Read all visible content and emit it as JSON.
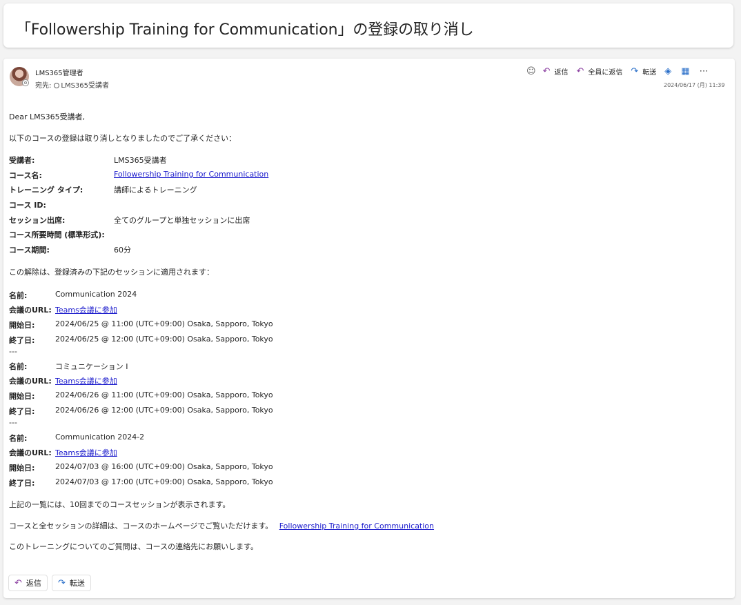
{
  "subject": "「Followership Training for Communication」の登録の取り消し",
  "header": {
    "sender": "LMS365管理者",
    "to_label": "宛先:",
    "recipient": "LMS365受講者",
    "date": "2024/06/17 (月) 11:39",
    "toolbar": {
      "reply": "返信",
      "reply_all": "全員に返信",
      "forward": "転送"
    }
  },
  "body": {
    "greeting": "Dear LMS365受講者,",
    "intro": "以下のコースの登録は取り消しとなりましたのでご了承ください：",
    "details": [
      {
        "label": "受講者:",
        "value": "LMS365受講者"
      },
      {
        "label": "コース名:",
        "value": "Followership Training for Communication"
      },
      {
        "label": "トレーニング タイプ:",
        "value": "講師によるトレーニング"
      },
      {
        "label": "コース ID:",
        "value": ""
      },
      {
        "label": "セッション出席:",
        "value": "全てのグループと単独セッションに出席"
      },
      {
        "label": "コース所要時間 (標準形式):",
        "value": ""
      },
      {
        "label": "コース期間:",
        "value": "60分"
      }
    ],
    "sessions_intro": "この解除は、登録済みの下記のセッションに適用されます：",
    "labels": {
      "name": "名前:",
      "url": "会議のURL:",
      "start": "開始日:",
      "end": "終了日:",
      "separator": "---"
    },
    "sessions": [
      {
        "name": "Communication 2024",
        "url": "Teams会議に参加",
        "start": "2024/06/25 @ 11:00 (UTC+09:00) Osaka, Sapporo, Tokyo",
        "end": "2024/06/25 @ 12:00 (UTC+09:00) Osaka, Sapporo, Tokyo"
      },
      {
        "name": "コミュニケーション I",
        "url": "Teams会議に参加",
        "start": "2024/06/26 @ 11:00 (UTC+09:00) Osaka, Sapporo, Tokyo",
        "end": "2024/06/26 @ 12:00 (UTC+09:00) Osaka, Sapporo, Tokyo"
      },
      {
        "name": "Communication 2024-2",
        "url": "Teams会議に参加",
        "start": "2024/07/03 @ 16:00 (UTC+09:00) Osaka, Sapporo, Tokyo",
        "end": "2024/07/03 @ 17:00 (UTC+09:00) Osaka, Sapporo, Tokyo"
      }
    ],
    "note": "上記の一覧には、10回までのコースセッションが表示されます。",
    "details_line": "コースと全セッションの詳細は、コースのホームページでご覧いただけます。",
    "homepage_link": "Followership Training for Communication",
    "contact": "このトレーニングについてのご質問は、コースの連絡先にお願いします。"
  },
  "footer": {
    "reply": "返信",
    "forward": "転送"
  },
  "icons": {
    "emoji": "smiley-icon",
    "reply": "reply-icon",
    "reply_all": "reply-all-icon",
    "forward": "forward-icon",
    "teams": "teams-icon",
    "immersive": "immersive-reader-icon",
    "more": "more-icon"
  }
}
